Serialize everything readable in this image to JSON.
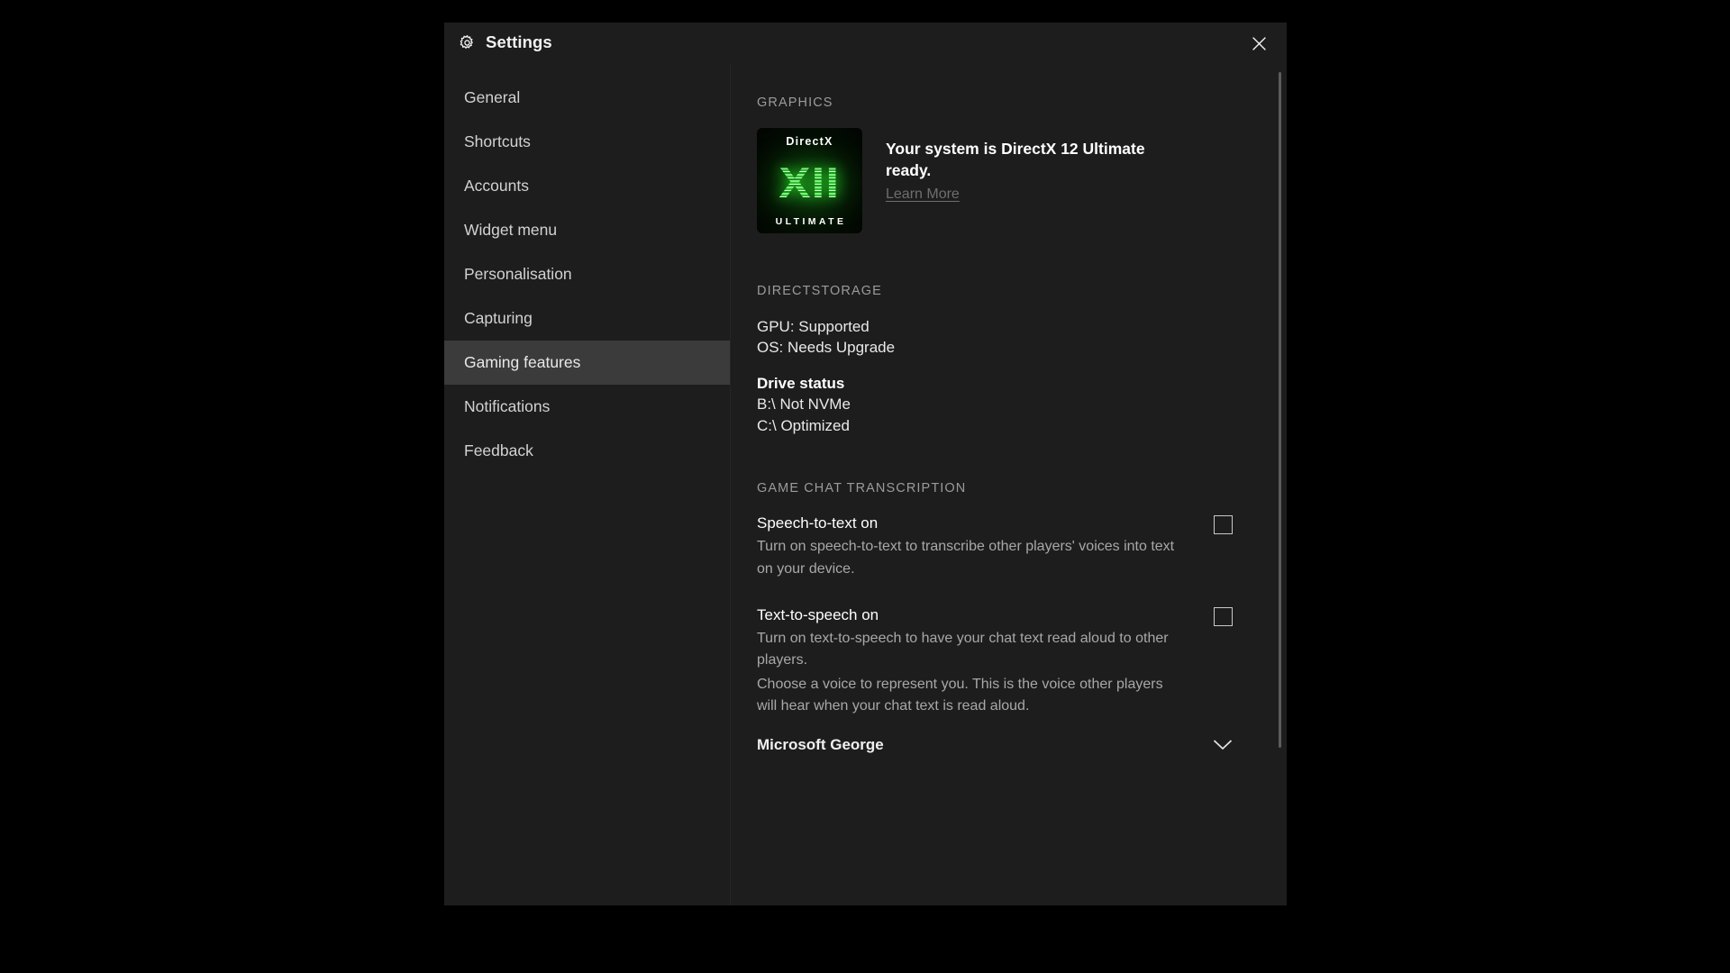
{
  "window": {
    "title": "Settings",
    "gear_icon": "gear-icon",
    "close_icon": "close-icon"
  },
  "sidebar": {
    "items": [
      {
        "label": "General",
        "active": false
      },
      {
        "label": "Shortcuts",
        "active": false
      },
      {
        "label": "Accounts",
        "active": false
      },
      {
        "label": "Widget menu",
        "active": false
      },
      {
        "label": "Personalisation",
        "active": false
      },
      {
        "label": "Capturing",
        "active": false
      },
      {
        "label": "Gaming features",
        "active": true
      },
      {
        "label": "Notifications",
        "active": false
      },
      {
        "label": "Feedback",
        "active": false
      }
    ]
  },
  "content": {
    "graphics": {
      "heading": "GRAPHICS",
      "badge": {
        "word": "DirectX",
        "version": "XII",
        "edition": "ULTIMATE",
        "glow_color": "#28dc28"
      },
      "headline": "Your system is DirectX 12 Ultimate ready.",
      "link": "Learn More"
    },
    "directstorage": {
      "heading": "DIRECTSTORAGE",
      "gpu_status": "GPU: Supported",
      "os_status": "OS: Needs Upgrade",
      "drive_status_label": "Drive status",
      "drives": [
        "B:\\ Not NVMe",
        "C:\\ Optimized"
      ]
    },
    "game_chat_transcription": {
      "heading": "GAME CHAT TRANSCRIPTION",
      "speech_to_text": {
        "title": "Speech-to-text on",
        "description": "Turn on speech-to-text to transcribe other players' voices into text on your device.",
        "checked": false
      },
      "text_to_speech": {
        "title": "Text-to-speech on",
        "description": "Turn on text-to-speech to have your chat text read aloud to other players.",
        "description2": "Choose a voice to represent you. This is the voice other players will hear when your chat text is read aloud.",
        "checked": false
      },
      "voice_select": {
        "value": "Microsoft George",
        "chevron_icon": "chevron-down-icon"
      }
    }
  }
}
